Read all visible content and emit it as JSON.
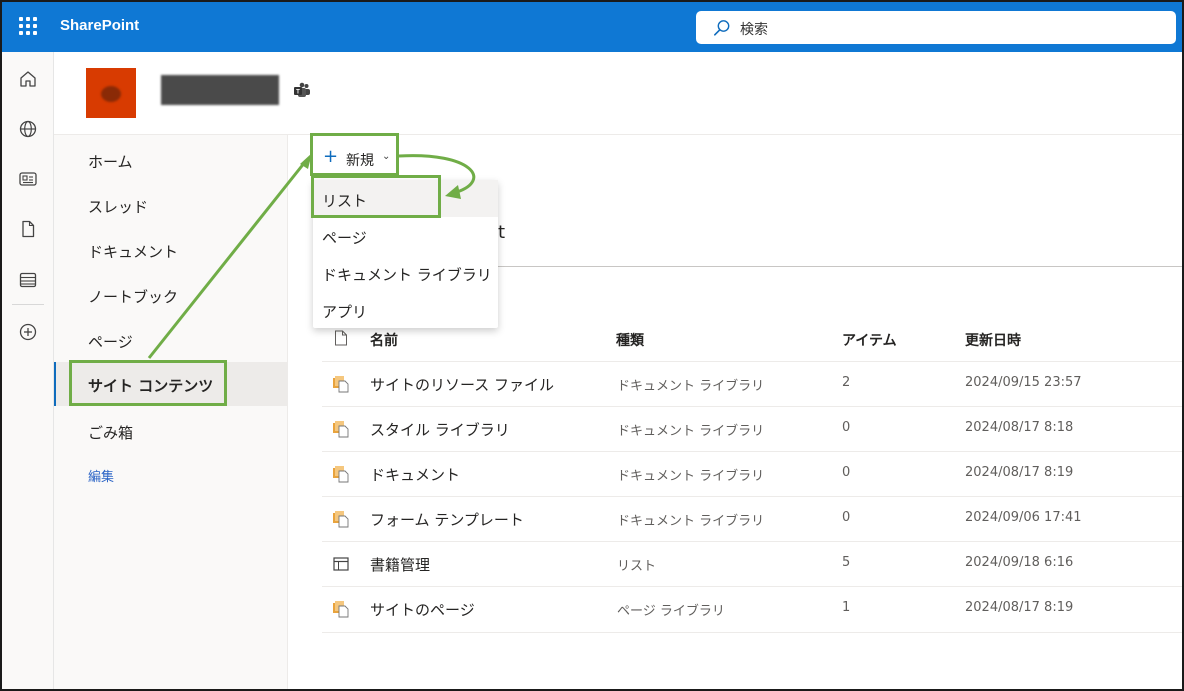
{
  "app": {
    "brand": "SharePoint",
    "search_placeholder": "検索"
  },
  "rail": {
    "icons": [
      "home-icon",
      "globe-icon",
      "news-icon",
      "file-icon",
      "list-icon",
      "add-circle-icon"
    ]
  },
  "leftnav": {
    "items": [
      {
        "label": "ホーム"
      },
      {
        "label": "スレッド"
      },
      {
        "label": "ドキュメント"
      },
      {
        "label": "ノートブック"
      },
      {
        "label": "ページ"
      },
      {
        "label": "サイト コンテンツ"
      },
      {
        "label": "ごみ箱"
      }
    ],
    "edit_label": "編集"
  },
  "command": {
    "new_label": "新規",
    "plus_glyph": "+",
    "chevron_glyph": "⌄"
  },
  "menu": {
    "items": [
      {
        "label": "リスト"
      },
      {
        "label": "ページ"
      },
      {
        "label": "ドキュメント ライブラリ"
      },
      {
        "label": "アプリ"
      }
    ]
  },
  "page": {
    "partial_title": "t"
  },
  "table": {
    "headers": {
      "name": "名前",
      "type": "種類",
      "items": "アイテム",
      "modified": "更新日時"
    },
    "rows": [
      {
        "name": "サイトのリソース ファイル",
        "type": "ドキュメント ライブラリ",
        "count": "2",
        "date": "2024/09/15 23:57",
        "icon": "library-icon"
      },
      {
        "name": "スタイル ライブラリ",
        "type": "ドキュメント ライブラリ",
        "count": "0",
        "date": "2024/08/17 8:18",
        "icon": "library-icon"
      },
      {
        "name": "ドキュメント",
        "type": "ドキュメント ライブラリ",
        "count": "0",
        "date": "2024/08/17 8:19",
        "icon": "library-icon"
      },
      {
        "name": "フォーム テンプレート",
        "type": "ドキュメント ライブラリ",
        "count": "0",
        "date": "2024/09/06 17:41",
        "icon": "library-icon"
      },
      {
        "name": "書籍管理",
        "type": "リスト",
        "count": "5",
        "date": "2024/09/18 6:16",
        "icon": "list-icon"
      },
      {
        "name": "サイトのページ",
        "type": "ページ ライブラリ",
        "count": "1",
        "date": "2024/08/17 8:19",
        "icon": "library-icon"
      }
    ]
  },
  "colors": {
    "suite_bar": "#0f78d4",
    "site_logo": "#d83b01",
    "annotation": "#70ad47",
    "accent": "#0f6cbd"
  }
}
